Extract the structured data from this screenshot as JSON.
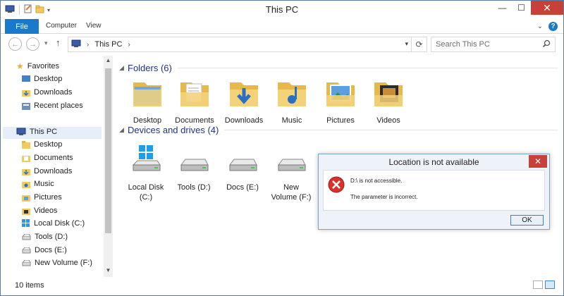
{
  "window": {
    "title": "This PC"
  },
  "ribbon": {
    "file_tab": "File",
    "tabs": [
      "Computer",
      "View"
    ]
  },
  "address": {
    "crumb": "This PC"
  },
  "search": {
    "placeholder": "Search This PC"
  },
  "navpane": {
    "favorites": {
      "label": "Favorites",
      "items": [
        "Desktop",
        "Downloads",
        "Recent places"
      ]
    },
    "thispc": {
      "label": "This PC",
      "items": [
        "Desktop",
        "Documents",
        "Downloads",
        "Music",
        "Pictures",
        "Videos",
        "Local Disk (C:)",
        "Tools (D:)",
        "Docs (E:)",
        "New Volume (F:)"
      ]
    }
  },
  "content": {
    "folders_header": "Folders (6)",
    "folders": [
      "Desktop",
      "Documents",
      "Downloads",
      "Music",
      "Pictures",
      "Videos"
    ],
    "drives_header": "Devices and drives (4)",
    "drives": [
      {
        "label": "Local Disk",
        "label2": "(C:)"
      },
      {
        "label": "Tools (D:)",
        "label2": ""
      },
      {
        "label": "Docs (E:)",
        "label2": ""
      },
      {
        "label": "New",
        "label2": "Volume (F:)"
      }
    ]
  },
  "status": {
    "count": "10 items"
  },
  "dialog": {
    "title": "Location is not available",
    "message1": "D:\\ is not accessible.",
    "message2": "The parameter is incorrect.",
    "ok_label": "OK"
  },
  "colors": {
    "file_tab": "#1979ca",
    "close_red": "#c7403a",
    "header_blue": "#1e3287",
    "folder_yellow": "#f2c95a"
  }
}
